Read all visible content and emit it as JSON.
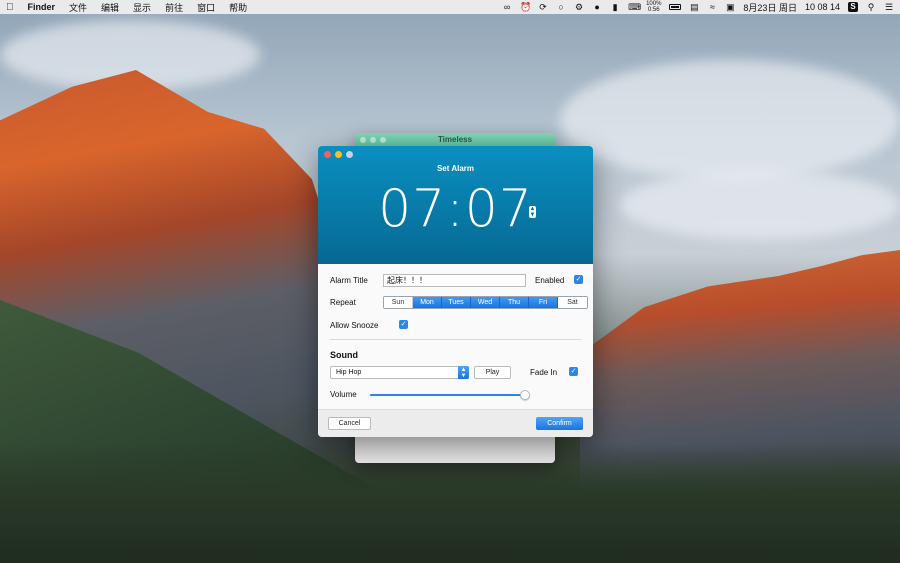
{
  "menubar": {
    "app_name": "Finder",
    "menus": [
      "文件",
      "编辑",
      "显示",
      "前往",
      "窗口",
      "帮助"
    ],
    "battery_percent": "100%",
    "battery_time": "0:56",
    "date": "8月23日 周日",
    "time": "10 08 14",
    "s_badge": "S"
  },
  "background_window": {
    "title": "Timeless"
  },
  "dialog": {
    "title": "Set Alarm",
    "time": "07:07",
    "alarm_title_label": "Alarm Title",
    "alarm_title_value": "起床！！！",
    "enabled_label": "Enabled",
    "enabled": true,
    "repeat_label": "Repeat",
    "days": [
      {
        "label": "Sun",
        "selected": false
      },
      {
        "label": "Mon",
        "selected": true
      },
      {
        "label": "Tues",
        "selected": true
      },
      {
        "label": "Wed",
        "selected": true
      },
      {
        "label": "Thu",
        "selected": true
      },
      {
        "label": "Fri",
        "selected": true
      },
      {
        "label": "Sat",
        "selected": false
      }
    ],
    "allow_snooze_label": "Allow Snooze",
    "allow_snooze": true,
    "sound_heading": "Sound",
    "sound_selected": "Hip Hop",
    "play_label": "Play",
    "fade_in_label": "Fade In",
    "fade_in": true,
    "volume_label": "Volume",
    "volume": 0.99,
    "cancel_label": "Cancel",
    "confirm_label": "Confirm"
  },
  "colors": {
    "header": "#087aa8",
    "accent": "#1a74e0",
    "background_titlebar": "#62c6a2"
  }
}
